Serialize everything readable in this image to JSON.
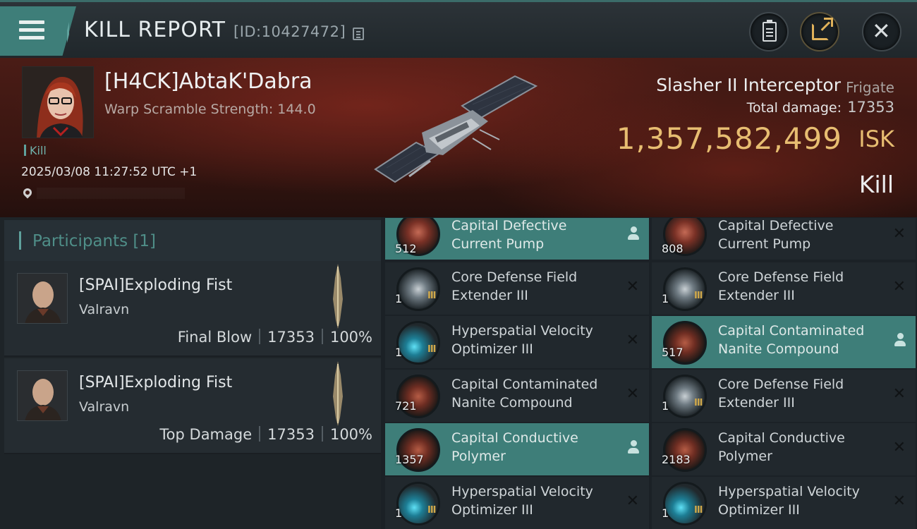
{
  "header": {
    "title": "KILL REPORT",
    "report_id": "[ID:10427472]"
  },
  "victim": {
    "name": "[H4CK]AbtaK'Dabra",
    "subtitle": "Warp Scramble Strength: 144.0",
    "kill_tag": "Kill",
    "timestamp": "2025/03/08 11:27:52 UTC +1"
  },
  "ship": {
    "name": "Slasher II Interceptor",
    "class": "Frigate",
    "total_damage_label": "Total damage:",
    "total_damage": "17353",
    "isk_value": "1,357,582,499",
    "isk_unit": "ISK",
    "result": "Kill"
  },
  "participants": {
    "header": "Participants [1]",
    "rows": [
      {
        "name": "[SPAI]Exploding Fist",
        "corp": "Valravn",
        "role": "Final Blow",
        "damage": "17353",
        "percent": "100%"
      },
      {
        "name": "[SPAI]Exploding Fist",
        "corp": "Valravn",
        "role": "Top Damage",
        "damage": "17353",
        "percent": "100%"
      }
    ]
  },
  "modules": [
    {
      "name": "Capital Defective Current Pump",
      "qty": "512",
      "tier": "",
      "icon": "red-pump-icon",
      "status": "dropped"
    },
    {
      "name": "Capital Defective Current Pump",
      "qty": "808",
      "tier": "",
      "icon": "red-pump-icon",
      "status": "destroyed"
    },
    {
      "name": "Core Defense Field Extender III",
      "qty": "1",
      "tier": "III",
      "icon": "shield-extender-icon",
      "status": "destroyed"
    },
    {
      "name": "Core Defense Field Extender III",
      "qty": "1",
      "tier": "III",
      "icon": "shield-extender-icon",
      "status": "destroyed"
    },
    {
      "name": "Hyperspatial Velocity Optimizer III",
      "qty": "1",
      "tier": "III",
      "icon": "velocity-optimizer-icon",
      "status": "destroyed"
    },
    {
      "name": "Capital Contaminated Nanite Compound",
      "qty": "517",
      "tier": "",
      "icon": "nanite-compound-icon",
      "status": "dropped"
    },
    {
      "name": "Capital Contaminated Nanite Compound",
      "qty": "721",
      "tier": "",
      "icon": "nanite-compound-icon",
      "status": "destroyed"
    },
    {
      "name": "Core Defense Field Extender III",
      "qty": "1",
      "tier": "III",
      "icon": "shield-extender-icon",
      "status": "destroyed"
    },
    {
      "name": "Capital Conductive Polymer",
      "qty": "1357",
      "tier": "",
      "icon": "conductive-polymer-icon",
      "status": "dropped"
    },
    {
      "name": "Capital Conductive Polymer",
      "qty": "2183",
      "tier": "",
      "icon": "conductive-polymer-icon",
      "status": "destroyed"
    },
    {
      "name": "Hyperspatial Velocity Optimizer III",
      "qty": "1",
      "tier": "III",
      "icon": "velocity-optimizer-icon",
      "status": "destroyed"
    },
    {
      "name": "Hyperspatial Velocity Optimizer III",
      "qty": "1",
      "tier": "III",
      "icon": "velocity-optimizer-icon",
      "status": "destroyed"
    }
  ],
  "colors": {
    "accent_teal": "#3e7e79",
    "isk_gold": "#e7bd71",
    "banner_red": "#4a1c16"
  }
}
